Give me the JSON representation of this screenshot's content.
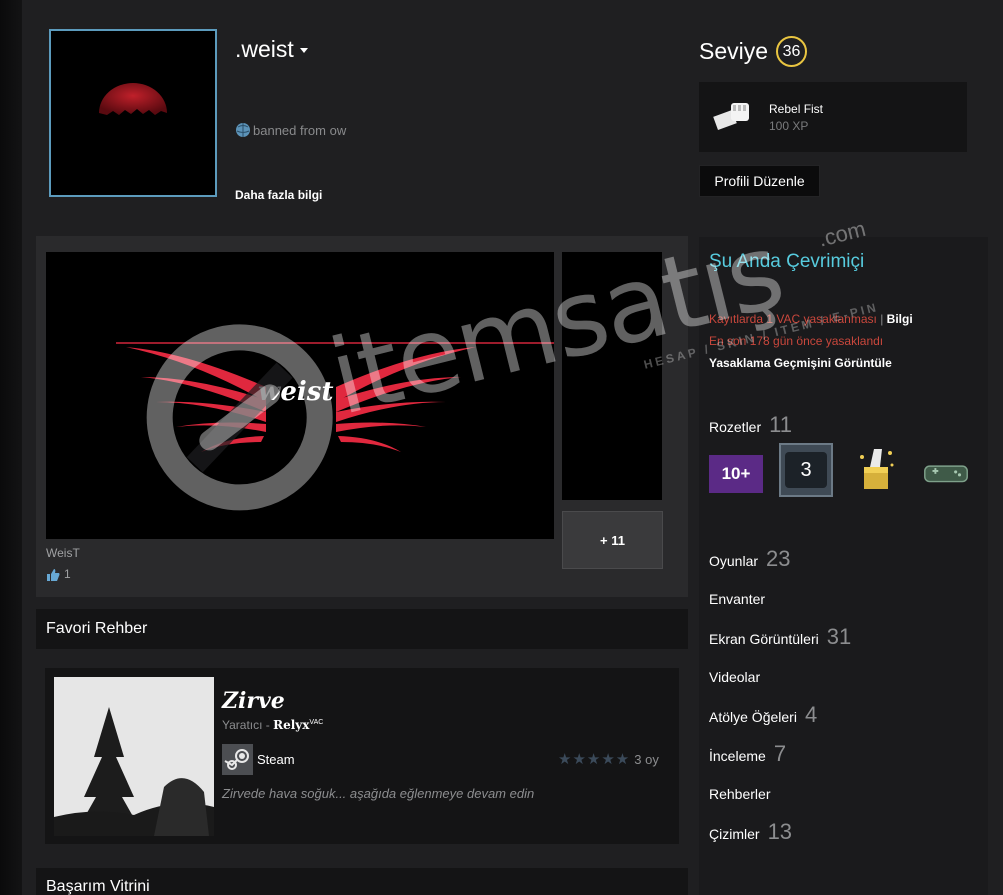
{
  "profile": {
    "username": ".weist",
    "status_text": "banned from ow",
    "more_info": "Daha fazla bilgi"
  },
  "level": {
    "label": "Seviye",
    "value": "36"
  },
  "favorite_badge": {
    "name": "Rebel Fist",
    "xp": "100 XP"
  },
  "edit_button": "Profili Düzenle",
  "showcase": {
    "artwork_title": "WeisT",
    "artwork_text": "weist",
    "likes": "1",
    "more_label": "+ 11"
  },
  "guide": {
    "header": "Favori Rehber",
    "title": "Zirve",
    "author_prefix": "Yaratıcı - ",
    "author": "Relyx",
    "author_tag": "VAC",
    "app_name": "Steam",
    "rating_count": "3 oy",
    "description": "Zirvede hava soğuk... aşağıda eğlenmeye devam edin"
  },
  "achievement_header": "Başarım Vitrini",
  "sidebar": {
    "online_status": "Şu Anda Çevrimiçi",
    "vac_text": "Kayıtlarda 1 VAC yasaklanması",
    "vac_sep": "|",
    "vac_info": "Bilgi",
    "vac_days": "En son 178 gün önce yasaklandı",
    "vac_history": "Yasaklama Geçmişini Görüntüle",
    "badges_label": "Rozetler",
    "badges_count": "11",
    "badge_10plus": "10+",
    "badge_3": "3",
    "games_label": "Oyunlar",
    "games_count": "23",
    "inventory_label": "Envanter",
    "screenshots_label": "Ekran Görüntüleri",
    "screenshots_count": "31",
    "videos_label": "Videolar",
    "workshop_label": "Atölye Öğeleri",
    "workshop_count": "4",
    "reviews_label": "İnceleme",
    "reviews_count": "7",
    "guides_label": "Rehberler",
    "artwork_label": "Çizimler",
    "artwork_count": "13"
  },
  "watermark": {
    "brand": "itemsatış",
    "suffix": ".com",
    "tagline": "HESAP / SKIN / ITEM / E-PIN"
  },
  "colors": {
    "accent_blue": "#57cbde",
    "vac_red": "#c9473c",
    "level_ring": "#e9c541"
  }
}
